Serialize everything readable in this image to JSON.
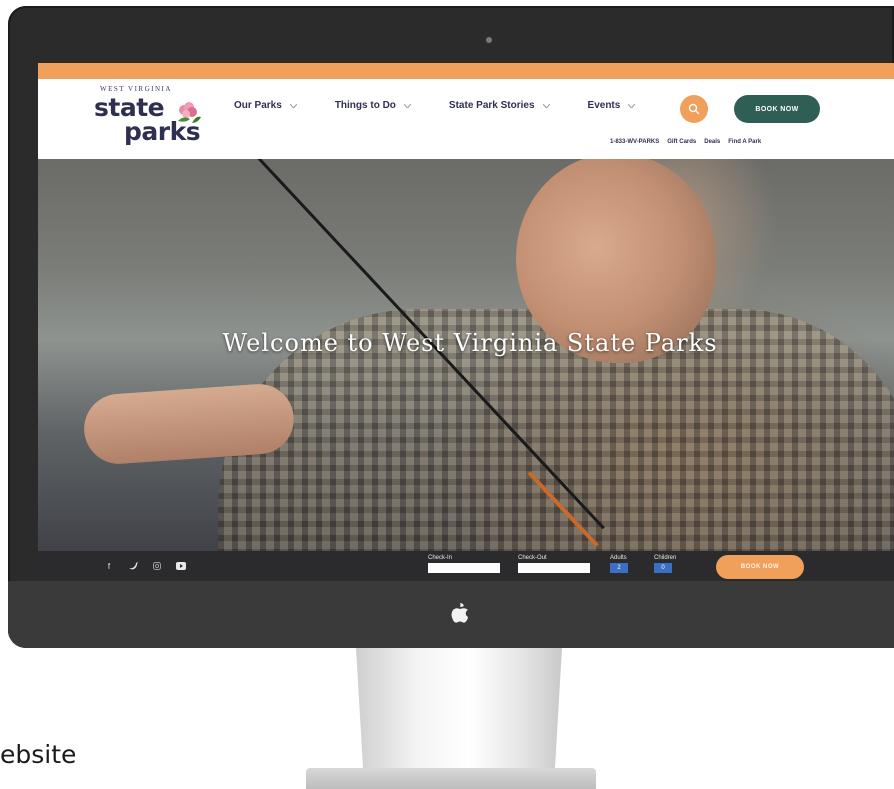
{
  "alert_bar": {
    "text": ""
  },
  "header": {
    "logo": {
      "small": "WEST VIRGINIA",
      "line1": "state",
      "line2": "parks"
    },
    "nav": [
      {
        "label": "Our Parks"
      },
      {
        "label": "Things to Do"
      },
      {
        "label": "State Park Stories"
      },
      {
        "label": "Events"
      }
    ],
    "book_button": "BOOK NOW",
    "utility": [
      "1-833-WV-PARKS",
      "Gift Cards",
      "Deals",
      "Find A Park"
    ]
  },
  "hero": {
    "title": "Welcome to West Virginia State Parks",
    "subtitle": ""
  },
  "booking_bar": {
    "check_in": {
      "label": "Check-In",
      "value": ""
    },
    "check_out": {
      "label": "Check-Out",
      "value": ""
    },
    "adults": {
      "label": "Adults",
      "value": "2"
    },
    "children": {
      "label": "Children",
      "value": "0"
    },
    "book_button": "BOOK NOW"
  },
  "caption": "ebsite",
  "colors": {
    "accent": "#f0a05a",
    "navy": "#2f2f52",
    "teal": "#2f5e57"
  },
  "icons": [
    "search-icon",
    "chevron-down-icon",
    "facebook-icon",
    "twitter-icon",
    "instagram-icon",
    "youtube-icon",
    "apple-logo-icon",
    "flower-icon"
  ]
}
